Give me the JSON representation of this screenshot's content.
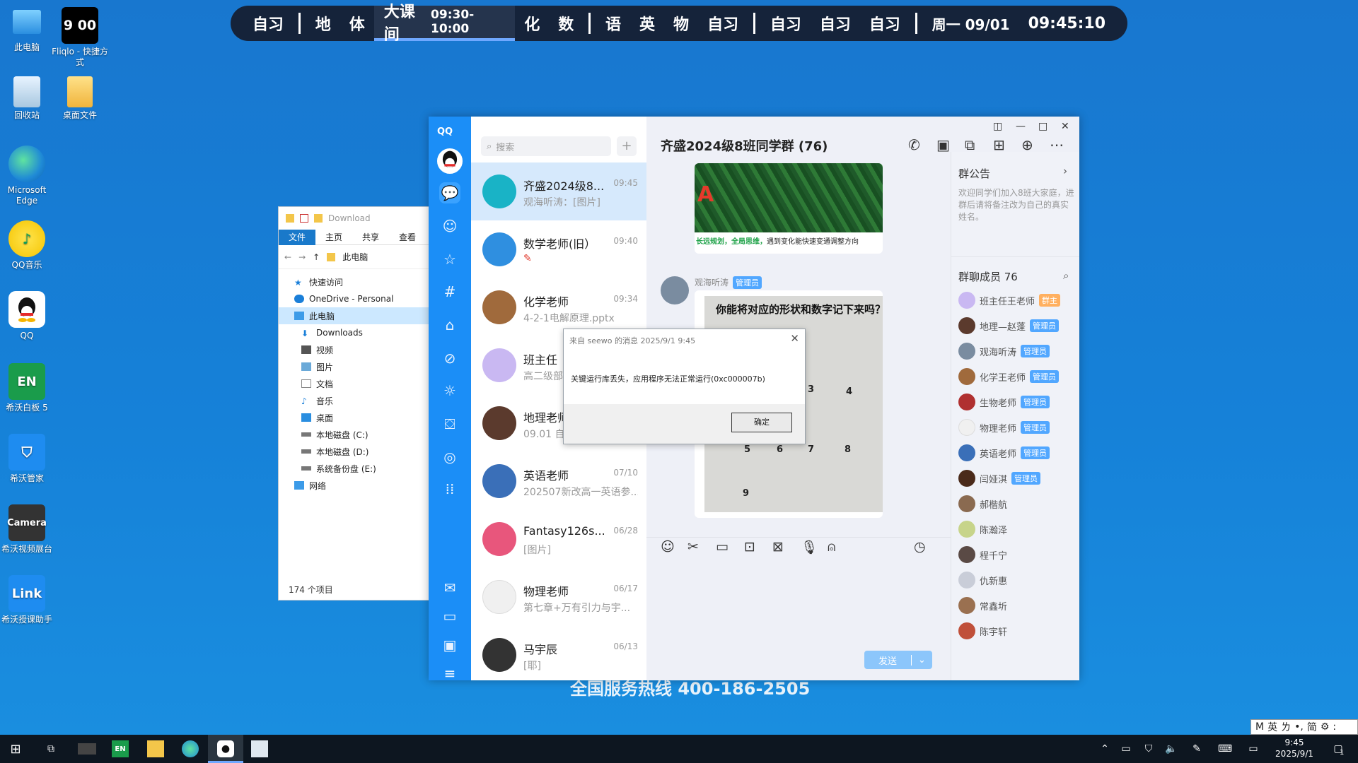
{
  "desktop": {
    "icons": [
      {
        "label": "此电脑",
        "icon": "computer-icon"
      },
      {
        "label": "Fliqlo - 快捷方式",
        "icon": "clock-icon",
        "clock": "9 00"
      },
      {
        "label": "回收站",
        "icon": "recycle-bin-icon"
      },
      {
        "label": "桌面文件",
        "icon": "folder-icon"
      },
      {
        "label": "Microsoft Edge",
        "icon": "edge-icon"
      },
      {
        "label": "QQ音乐",
        "icon": "qq-music-icon"
      },
      {
        "label": "QQ",
        "icon": "qq-icon"
      },
      {
        "label": "希沃白板 5",
        "icon": "seewo-whiteboard-icon",
        "short": "EN"
      },
      {
        "label": "希沃管家",
        "icon": "seewo-manager-icon"
      },
      {
        "label": "希沃视频展台",
        "icon": "camera-icon",
        "short": "Camera"
      },
      {
        "label": "希沃授课助手",
        "icon": "link-icon",
        "short": "Link"
      }
    ],
    "watermark": "全国服务热线 400-186-2505"
  },
  "schedule": {
    "items": [
      "自习",
      "|",
      "地",
      "体",
      "ACTIVE",
      "化",
      "数",
      "|",
      "语",
      "英",
      "物",
      "自习",
      "|",
      "自习",
      "自习",
      "自习",
      "|"
    ],
    "active_label": "大课间",
    "active_time": "09:30-10:00",
    "date": "周一 09/01",
    "clock": "09:45:10"
  },
  "explorer": {
    "title": "Download",
    "ribbon": [
      "文件",
      "主页",
      "共享",
      "查看"
    ],
    "path": "此电脑",
    "tree": [
      {
        "label": "快速访问",
        "icon": "star-icon",
        "sub": false
      },
      {
        "label": "OneDrive - Personal",
        "icon": "cloud-icon",
        "sub": false
      },
      {
        "label": "此电脑",
        "icon": "computer-icon",
        "sub": false,
        "selected": true
      },
      {
        "label": "Downloads",
        "icon": "download-icon",
        "sub": true
      },
      {
        "label": "视频",
        "icon": "video-icon",
        "sub": true
      },
      {
        "label": "图片",
        "icon": "picture-icon",
        "sub": true
      },
      {
        "label": "文档",
        "icon": "document-icon",
        "sub": true
      },
      {
        "label": "音乐",
        "icon": "music-icon",
        "sub": true
      },
      {
        "label": "桌面",
        "icon": "desktop-icon",
        "sub": true
      },
      {
        "label": "本地磁盘 (C:)",
        "icon": "drive-icon",
        "sub": true
      },
      {
        "label": "本地磁盘 (D:)",
        "icon": "drive-icon",
        "sub": true
      },
      {
        "label": "系统备份盘 (E:)",
        "icon": "drive-icon",
        "sub": true
      },
      {
        "label": "网络",
        "icon": "network-icon",
        "sub": false
      }
    ],
    "status": "174 个项目"
  },
  "qq": {
    "logo": "QQ",
    "search_placeholder": "搜索",
    "conversations": [
      {
        "name": "齐盛2024级8...",
        "time": "09:45",
        "msg": "观海听涛：[图片]",
        "selected": true,
        "color": "#19b3c6"
      },
      {
        "name": "数学老师(旧）",
        "time": "09:40",
        "msg": "✎",
        "color": "#2f8fe0"
      },
      {
        "name": "化学老师",
        "time": "09:34",
        "msg": "4-2-1电解原理.pptx",
        "color": "#a06a3c"
      },
      {
        "name": "班主任",
        "time": "",
        "msg": "高二级部",
        "color": "#c9b8f2"
      },
      {
        "name": "地理老师",
        "time": "",
        "msg": "09.01 自",
        "color": "#5b3a2d"
      },
      {
        "name": "英语老师",
        "time": "07/10",
        "msg": "202507新改高一英语参...",
        "color": "#3a6fb8"
      },
      {
        "name": "Fantasy126s...",
        "time": "06/28",
        "msg": "[图片]",
        "color": "#e8567c"
      },
      {
        "name": "物理老师",
        "time": "06/17",
        "msg": "第七章+万有引力与宇...",
        "color": "#f0f0f0"
      },
      {
        "name": "马宇辰",
        "time": "06/13",
        "msg": "[耶]",
        "color": "#333"
      }
    ],
    "chat": {
      "title": "齐盛2024级8班同学群 (76)",
      "image_caption_green": "长远规划，全局思维，",
      "image_caption_rest": "遇到变化能快速变通调整方向",
      "sender": "观海听涛",
      "sender_badge": "管理员",
      "worksheet_title": "你能将对应的形状和数字记下来吗？",
      "worksheet_numbers": [
        "3",
        "4",
        "5",
        "6",
        "7",
        "8",
        "9"
      ],
      "send_label": "发送"
    },
    "panel": {
      "notice_title": "群公告",
      "notice_text": "欢迎同学们加入8班大家庭，进群后请将备注改为自己的真实姓名。",
      "members_title": "群聊成员 76",
      "members": [
        {
          "name": "班主任王老师",
          "badge": "群主",
          "owner": true,
          "color": "#c9b8f2"
        },
        {
          "name": "地理—赵蓬",
          "badge": "管理员",
          "color": "#5b3a2d"
        },
        {
          "name": "观海听涛",
          "badge": "管理员",
          "color": "#7a8ca0"
        },
        {
          "name": "化学王老师",
          "badge": "管理员",
          "color": "#a06a3c"
        },
        {
          "name": "生物老师",
          "badge": "管理员",
          "color": "#b03030"
        },
        {
          "name": "物理老师",
          "badge": "管理员",
          "color": "#f0f0f0"
        },
        {
          "name": "英语老师",
          "badge": "管理员",
          "color": "#3a6fb8"
        },
        {
          "name": "闫娅淇",
          "badge": "管理员",
          "color": "#4a2a1a"
        },
        {
          "name": "郝楷航",
          "badge": "",
          "color": "#8a6a50"
        },
        {
          "name": "陈瀚泽",
          "badge": "",
          "color": "#c7d48a"
        },
        {
          "name": "程千宁",
          "badge": "",
          "color": "#5a4a45"
        },
        {
          "name": "仇新惠",
          "badge": "",
          "color": "#c9cdd8"
        },
        {
          "name": "常鑫圻",
          "badge": "",
          "color": "#9a7050"
        },
        {
          "name": "陈宇轩",
          "badge": "",
          "color": "#c0503a"
        }
      ]
    }
  },
  "dialog": {
    "title": "来自 seewo 的消息 2025/9/1 9:45",
    "message": "关键运行库丢失，应用程序无法正常运行(0xc000007b)",
    "ok_label": "确定"
  },
  "taskbar": {
    "time": "9:45",
    "date": "2025/9/1",
    "notification_count": "1",
    "ime": [
      "M",
      "英",
      "ㄌ",
      "•,",
      "简",
      "⚙",
      ":"
    ]
  }
}
